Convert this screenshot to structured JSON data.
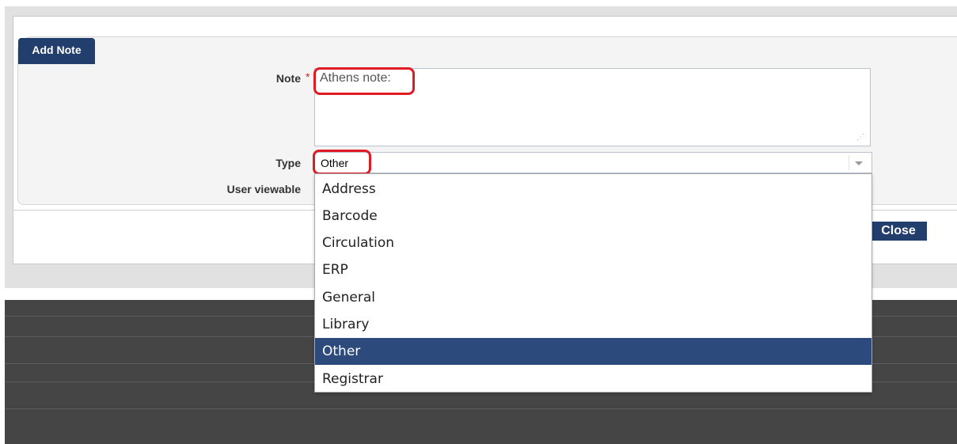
{
  "dialog": {
    "header_title": "Add Note",
    "note_label": "Note",
    "required_marker": "*",
    "note_value": "Athens note:",
    "type_label": "Type",
    "type_selected": "Other",
    "user_viewable_label": "User viewable",
    "close_label": "Close"
  },
  "dropdown": {
    "options": [
      "Address",
      "Barcode",
      "Circulation",
      "ERP",
      "General",
      "Library",
      "Other",
      "Registrar"
    ],
    "selected_index": 6
  },
  "colors": {
    "header": "#223e6d",
    "selected_option": "#2c4a7c",
    "annotation": "#e01b24",
    "backdrop": "#454545"
  }
}
